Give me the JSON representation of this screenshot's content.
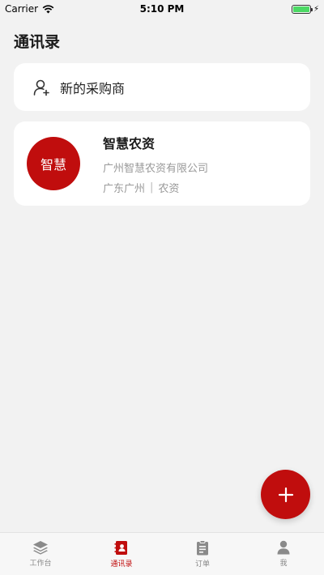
{
  "status_bar": {
    "carrier": "Carrier",
    "time": "5:10 PM",
    "battery_level": 1.0
  },
  "page": {
    "title": "通讯录"
  },
  "new_supplier": {
    "label": "新的采购商",
    "icon": "add-user-icon"
  },
  "contacts": [
    {
      "avatar_text": "智慧",
      "name": "智慧农资",
      "company": "广州智慧农资有限公司",
      "location": "广东广州",
      "separator": "|",
      "category": "农资"
    }
  ],
  "fab": {
    "icon": "plus-icon"
  },
  "tabbar": {
    "items": [
      {
        "label": "工作台",
        "icon": "layers-icon",
        "active": false
      },
      {
        "label": "通讯录",
        "icon": "contacts-book-icon",
        "active": true
      },
      {
        "label": "订单",
        "icon": "clipboard-icon",
        "active": false
      },
      {
        "label": "我",
        "icon": "person-icon",
        "active": false
      }
    ]
  },
  "colors": {
    "accent": "#c00d0d",
    "background": "#f2f2f2",
    "inactive_tab": "#888888"
  }
}
